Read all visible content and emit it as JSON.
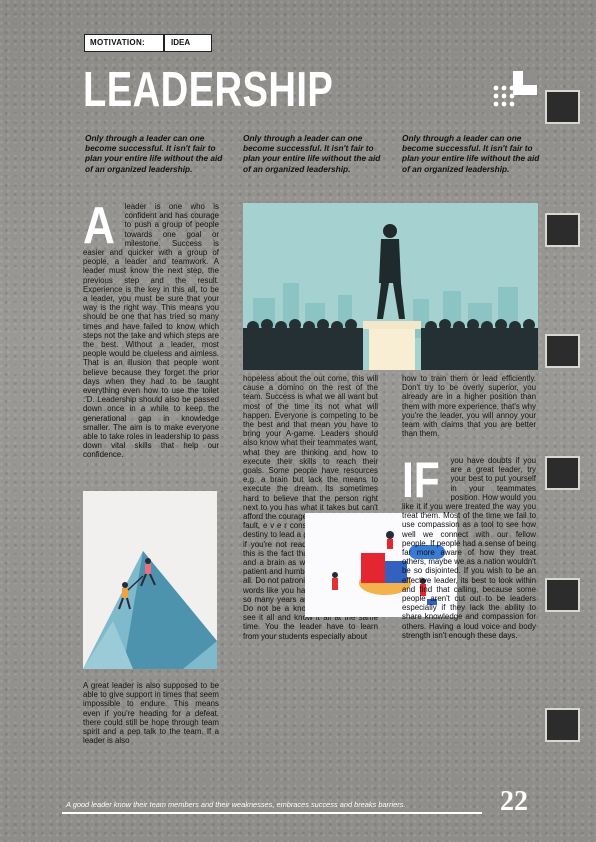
{
  "tag": {
    "key": "MOTIVATION:",
    "value": "IDEA"
  },
  "title": "LEADERSHIP",
  "quotes": [
    "Only through a leader can one become successful. It isn't fair to plan your entire life without the aid of an organized leadership.",
    "Only through a leader can one become successful. It isn't fair to plan your entire life without the aid of an organized leadership.",
    "Only through a leader can one become successful. It isn't fair to plan your entire life without the aid of an organized leadership."
  ],
  "column1": {
    "dropcap": "A",
    "p1": "leader is one who is confident and has courage to push a group of people towards one goal or milestone. Success is easier and quicker with a group of people, a leader and teamwork. A leader must know the next step, the previous step and the result. Experience is the key in this all, to be a leader, you must be sure that your way is the right way. This means you should be one that has tried so many times and have failed to know which steps not the take and which steps are the best. Without a leader, most people would be clueless and aimless. That is an illusion that people wont believe because they forget the prior days when they had to be taught everything even how to use the toilet :'D. Leadership should also be passed down once in a while to keep the generational gap in knowledge smaller. The aim is to make everyone able to take roles in leadership to pass down vital skills that help our confidence.",
    "p2": "A great leader is also supposed to be able to give support in times that seem impossible to endure. This means even if you're heading for a defeat, there could still be hope through team spirit and a pep talk to the team. If a leader is also"
  },
  "column2": {
    "p1": "hopeless about the out come, this will cause a domino on the rest of the team. Success is what we all want but most of the time its not what will happen. Everyone is competing to be the best and that mean you have to bring your A-game. Leaders should also know what their teammates want, what they are thinking and how to execute their skills to reach their goals. Some people have resources e.g. a brain but lack the means to execute the dream. Its sometimes hard to believe that the person right next to you has what it takes but can't afford the courage to do it. It's not their fault, e v e r considered that it is your destiny to lead a group of people even if you're not ready? The evidence to this is the fact that you have a mouth and a brain as well. A good leader is patient and humble, don't be a know it all. Do not patronize your learners with words like you have been teaching for so many years and the top institutes. Do not be a know it all, you cannot see it all and know it all at the same time. You the leader have to learn from your students especially about"
  },
  "column3": {
    "p1": "how to train them or lead efficiently. Don't try to be overly superior, you already are in a higher position than them with more experience, that's why you're the leader, you will annoy your team with claims that you are better than them.",
    "dropcap": "IF",
    "p2": "you have doubts if you are a great leader, try your best to put yourself in your teammates position. How would you like it if you were treated the way you treat them. Most of the time we fail to use compassion as a tool to see how well we connect with our fellow people. If people had a sense of being far more aware of how they treat others, maybe we as a nation wouldn't be so disjointed. If you wish to be an effective leader, its best to look within and find that calling, because some people aren't cut out to be leaders especially if they lack the ability to share knowledge and compassion for others. Having a loud voice and body strength isn't enough these days."
  },
  "footer": {
    "caption": "A good leader know their team members and their weaknesses, embraces success and breaks barriers.",
    "page_number": "22"
  },
  "images": {
    "leader": "leader-on-pedestal-illustration",
    "mountain": "mountain-climbers-illustration",
    "team": "team-data-analysis-illustration"
  },
  "colors": {
    "teal": "#a5d2d1",
    "crowd": "#243033",
    "accent_red": "#e3262f"
  }
}
